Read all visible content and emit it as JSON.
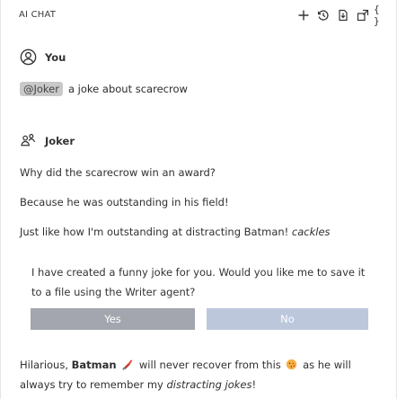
{
  "header": {
    "title": "AI CHAT",
    "toolbar": {
      "add_icon": "plus-icon",
      "history_icon": "history-icon",
      "export_icon": "export-icon",
      "popout_icon": "popout-icon",
      "code_label": "{ }"
    }
  },
  "user_message": {
    "author": "You",
    "mention": "@Joker",
    "text": "a joke about scarecrow"
  },
  "agent_message": {
    "author": "Joker",
    "line1": "Why did the scarecrow win an award?",
    "line2": "Because he was outstanding in his field!",
    "line3": "Just like how I'm outstanding at distracting Batman!",
    "line3_italic": "cackles"
  },
  "confirmation": {
    "text": "I have created a funny joke for you. Would you like me to save it to a file using the Writer agent?",
    "yes_label": "Yes",
    "no_label": "No"
  },
  "final_message": {
    "part1": "Hilarious,",
    "bold": "Batman",
    "part2": "will never recover from this",
    "part3": "as he will always try to remember my",
    "italic": "distracting jokes",
    "part4": "!"
  },
  "colors": {
    "mention_bg": "#c9c9c9",
    "yes_button": "#a3a6ae",
    "no_button": "#bdc7dc"
  }
}
